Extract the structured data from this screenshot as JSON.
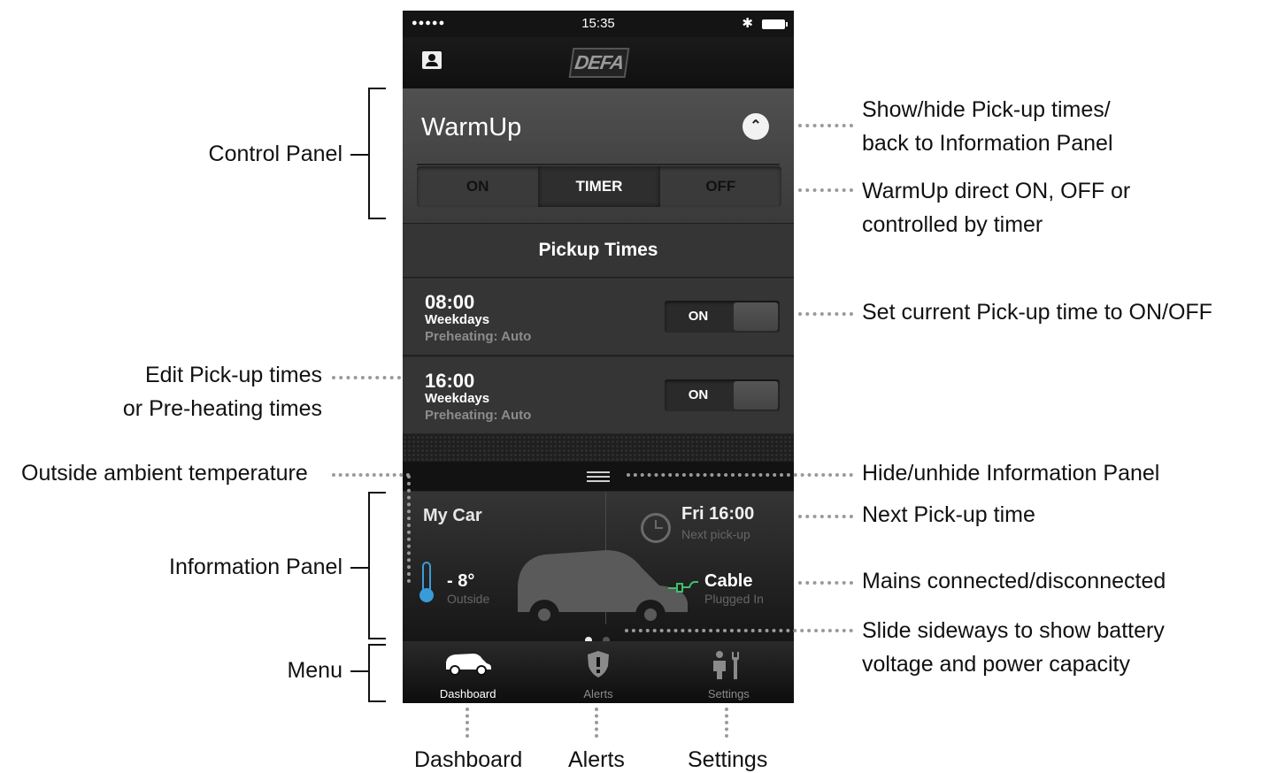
{
  "status_bar": {
    "signal": "●●●●●",
    "time": "15:35",
    "bluetooth": "✱"
  },
  "nav": {
    "logo": "DEFA"
  },
  "control_panel": {
    "title": "WarmUp",
    "collapse_glyph": "⌃",
    "modes": [
      {
        "label": "ON",
        "active": false
      },
      {
        "label": "TIMER",
        "active": true
      },
      {
        "label": "OFF",
        "active": false
      }
    ]
  },
  "pickup": {
    "header": "Pickup Times",
    "items": [
      {
        "time": "08:00",
        "days": "Weekdays",
        "preheat": "Preheating: Auto",
        "state": "ON"
      },
      {
        "time": "16:00",
        "days": "Weekdays",
        "preheat": "Preheating: Auto",
        "state": "ON"
      }
    ]
  },
  "info_panel": {
    "car_name": "My Car",
    "next_time": "Fri 16:00",
    "next_label": "Next pick-up",
    "temperature": "- 8°",
    "temperature_label": "Outside",
    "mains": "Cable",
    "mains_label": "Plugged In",
    "page_count": 2,
    "active_page": 1
  },
  "tabs": [
    {
      "label": "Dashboard",
      "icon": "car-icon",
      "active": true
    },
    {
      "label": "Alerts",
      "icon": "shield-alert-icon",
      "active": false
    },
    {
      "label": "Settings",
      "icon": "person-wrench-icon",
      "active": false
    }
  ],
  "annotations": {
    "control_panel": "Control Panel",
    "information_panel": "Information Panel",
    "menu": "Menu",
    "edit_line1": "Edit Pick-up times",
    "edit_line2": "or Pre-heating times",
    "outside_temp": "Outside ambient temperature",
    "show_hide_line1": "Show/hide Pick-up times/",
    "show_hide_line2": "back to Information Panel",
    "warmup_line1": "WarmUp direct ON, OFF or",
    "warmup_line2": "controlled by timer",
    "set_pickup": "Set current Pick-up time to ON/OFF",
    "hide_info": "Hide/unhide Information Panel",
    "next_pickup": "Next Pick-up time",
    "mains": "Mains connected/disconnected",
    "slide_line1": "Slide sideways to show battery",
    "slide_line2": "voltage and power capacity",
    "tab_dashboard": "Dashboard",
    "tab_alerts": "Alerts",
    "tab_settings": "Settings"
  }
}
